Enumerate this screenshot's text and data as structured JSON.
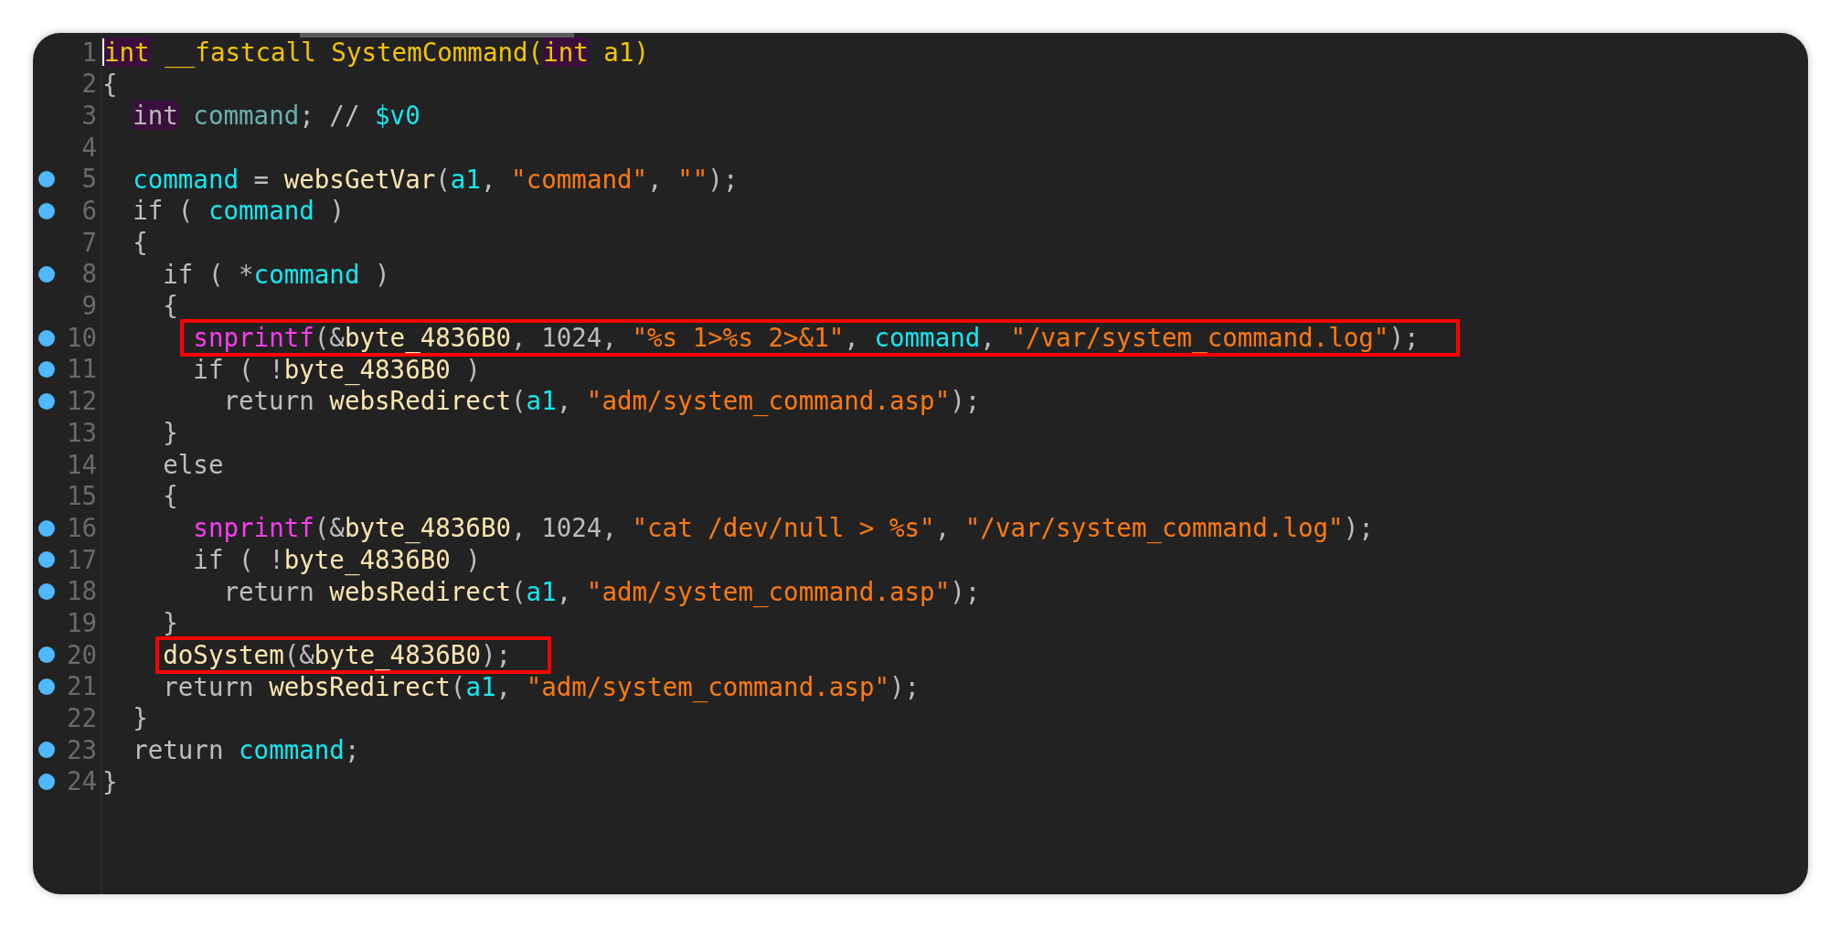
{
  "editor": {
    "lines": [
      {
        "number": "1",
        "breakpoint": false,
        "highlighted": false,
        "cursor": true,
        "tokens": [
          {
            "kind": "type",
            "text": "int"
          },
          {
            "kind": "decl",
            "text": " __fastcall SystemCommand("
          },
          {
            "kind": "type",
            "text": "int"
          },
          {
            "kind": "decl",
            "text": " a1)"
          }
        ]
      },
      {
        "number": "2",
        "breakpoint": false,
        "highlighted": false,
        "cursor": false,
        "tokens": [
          {
            "kind": "plain",
            "text": "{"
          }
        ]
      },
      {
        "number": "3",
        "breakpoint": false,
        "highlighted": false,
        "cursor": false,
        "tokens": [
          {
            "kind": "type_muted",
            "text": "  int"
          },
          {
            "kind": "local",
            "text": " command"
          },
          {
            "kind": "plain",
            "text": "; // "
          },
          {
            "kind": "var",
            "text": "$v0"
          }
        ]
      },
      {
        "number": "4",
        "breakpoint": false,
        "highlighted": false,
        "cursor": false
      },
      {
        "number": "5",
        "breakpoint": true,
        "highlighted": false,
        "cursor": false,
        "tokens": [
          {
            "kind": "var",
            "text": "  command"
          },
          {
            "kind": "plain",
            "text": " = "
          },
          {
            "kind": "fn",
            "text": "websGetVar"
          },
          {
            "kind": "plain",
            "text": "("
          },
          {
            "kind": "var",
            "text": "a1"
          },
          {
            "kind": "plain",
            "text": ", "
          },
          {
            "kind": "str",
            "text": "\"command\""
          },
          {
            "kind": "plain",
            "text": ", "
          },
          {
            "kind": "str",
            "text": "\"\""
          },
          {
            "kind": "plain",
            "text": ");"
          }
        ]
      },
      {
        "number": "6",
        "breakpoint": true,
        "highlighted": false,
        "cursor": false,
        "tokens": [
          {
            "kind": "plain",
            "text": "  if ( "
          },
          {
            "kind": "var",
            "text": "command"
          },
          {
            "kind": "plain",
            "text": " )"
          }
        ]
      },
      {
        "number": "7",
        "breakpoint": false,
        "highlighted": false,
        "cursor": false,
        "tokens": [
          {
            "kind": "plain",
            "text": "  {"
          }
        ]
      },
      {
        "number": "8",
        "breakpoint": true,
        "highlighted": false,
        "cursor": false,
        "tokens": [
          {
            "kind": "plain",
            "text": "    if ( *"
          },
          {
            "kind": "var",
            "text": "command"
          },
          {
            "kind": "plain",
            "text": " )"
          }
        ]
      },
      {
        "number": "9",
        "breakpoint": false,
        "highlighted": false,
        "cursor": false,
        "tokens": [
          {
            "kind": "plain",
            "text": "    {"
          }
        ]
      },
      {
        "number": "10",
        "breakpoint": true,
        "highlighted": true,
        "cursor": false,
        "tokens": [
          {
            "kind": "lib",
            "text": "      snprintf"
          },
          {
            "kind": "plain",
            "text": "(&"
          },
          {
            "kind": "fn",
            "text": "byte_4836B0"
          },
          {
            "kind": "plain",
            "text": ", 1024, "
          },
          {
            "kind": "str",
            "text": "\"%s 1>%s 2>&1\""
          },
          {
            "kind": "plain",
            "text": ", "
          },
          {
            "kind": "var",
            "text": "command"
          },
          {
            "kind": "plain",
            "text": ", "
          },
          {
            "kind": "str",
            "text": "\"/var/system_command.log\""
          },
          {
            "kind": "plain",
            "text": ");"
          }
        ]
      },
      {
        "number": "11",
        "breakpoint": true,
        "highlighted": false,
        "cursor": false,
        "tokens": [
          {
            "kind": "plain",
            "text": "      if ( !"
          },
          {
            "kind": "fn",
            "text": "byte_4836B0"
          },
          {
            "kind": "plain",
            "text": " )"
          }
        ]
      },
      {
        "number": "12",
        "breakpoint": true,
        "highlighted": false,
        "cursor": false,
        "tokens": [
          {
            "kind": "plain",
            "text": "        return "
          },
          {
            "kind": "fn",
            "text": "websRedirect"
          },
          {
            "kind": "plain",
            "text": "("
          },
          {
            "kind": "var",
            "text": "a1"
          },
          {
            "kind": "plain",
            "text": ", "
          },
          {
            "kind": "str",
            "text": "\"adm/system_command.asp\""
          },
          {
            "kind": "plain",
            "text": ");"
          }
        ]
      },
      {
        "number": "13",
        "breakpoint": false,
        "highlighted": false,
        "cursor": false,
        "tokens": [
          {
            "kind": "plain",
            "text": "    }"
          }
        ]
      },
      {
        "number": "14",
        "breakpoint": false,
        "highlighted": false,
        "cursor": false,
        "tokens": [
          {
            "kind": "plain",
            "text": "    else"
          }
        ]
      },
      {
        "number": "15",
        "breakpoint": false,
        "highlighted": false,
        "cursor": false,
        "tokens": [
          {
            "kind": "plain",
            "text": "    {"
          }
        ]
      },
      {
        "number": "16",
        "breakpoint": true,
        "highlighted": false,
        "cursor": false,
        "tokens": [
          {
            "kind": "lib",
            "text": "      snprintf"
          },
          {
            "kind": "plain",
            "text": "(&"
          },
          {
            "kind": "fn",
            "text": "byte_4836B0"
          },
          {
            "kind": "plain",
            "text": ", 1024, "
          },
          {
            "kind": "str",
            "text": "\"cat /dev/null > %s\""
          },
          {
            "kind": "plain",
            "text": ", "
          },
          {
            "kind": "str",
            "text": "\"/var/system_command.log\""
          },
          {
            "kind": "plain",
            "text": ");"
          }
        ]
      },
      {
        "number": "17",
        "breakpoint": true,
        "highlighted": false,
        "cursor": false,
        "tokens": [
          {
            "kind": "plain",
            "text": "      if ( !"
          },
          {
            "kind": "fn",
            "text": "byte_4836B0"
          },
          {
            "kind": "plain",
            "text": " )"
          }
        ]
      },
      {
        "number": "18",
        "breakpoint": true,
        "highlighted": false,
        "cursor": false,
        "tokens": [
          {
            "kind": "plain",
            "text": "        return "
          },
          {
            "kind": "fn",
            "text": "websRedirect"
          },
          {
            "kind": "plain",
            "text": "("
          },
          {
            "kind": "var",
            "text": "a1"
          },
          {
            "kind": "plain",
            "text": ", "
          },
          {
            "kind": "str",
            "text": "\"adm/system_command.asp\""
          },
          {
            "kind": "plain",
            "text": ");"
          }
        ]
      },
      {
        "number": "19",
        "breakpoint": false,
        "highlighted": false,
        "cursor": false,
        "tokens": [
          {
            "kind": "plain",
            "text": "    }"
          }
        ]
      },
      {
        "number": "20",
        "breakpoint": true,
        "highlighted": true,
        "cursor": false,
        "tokens": [
          {
            "kind": "fn",
            "text": "    doSystem"
          },
          {
            "kind": "plain",
            "text": "(&"
          },
          {
            "kind": "fn",
            "text": "byte_4836B0"
          },
          {
            "kind": "plain",
            "text": ");"
          }
        ]
      },
      {
        "number": "21",
        "breakpoint": true,
        "highlighted": false,
        "cursor": false,
        "tokens": [
          {
            "kind": "plain",
            "text": "    return "
          },
          {
            "kind": "fn",
            "text": "websRedirect"
          },
          {
            "kind": "plain",
            "text": "("
          },
          {
            "kind": "var",
            "text": "a1"
          },
          {
            "kind": "plain",
            "text": ", "
          },
          {
            "kind": "str",
            "text": "\"adm/system_command.asp\""
          },
          {
            "kind": "plain",
            "text": ");"
          }
        ]
      },
      {
        "number": "22",
        "breakpoint": false,
        "highlighted": false,
        "cursor": false,
        "tokens": [
          {
            "kind": "plain",
            "text": "  }"
          }
        ]
      },
      {
        "number": "23",
        "breakpoint": true,
        "highlighted": false,
        "cursor": false,
        "tokens": [
          {
            "kind": "plain",
            "text": "  return "
          },
          {
            "kind": "var",
            "text": "command"
          },
          {
            "kind": "plain",
            "text": ";"
          }
        ]
      },
      {
        "number": "24",
        "breakpoint": true,
        "highlighted": false,
        "cursor": false,
        "tokens": [
          {
            "kind": "plain",
            "text": "}"
          }
        ]
      }
    ]
  }
}
